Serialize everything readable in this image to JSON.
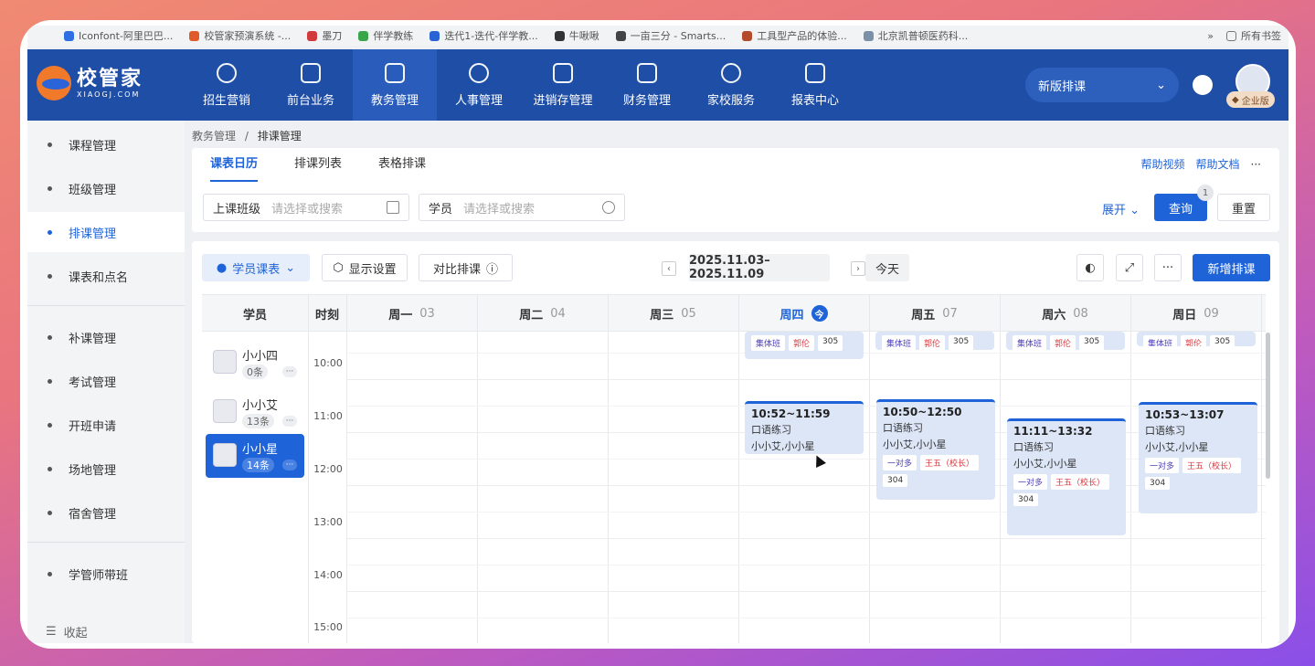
{
  "bookmarks": [
    {
      "label": "Iconfont-阿里巴巴...",
      "color": "#2f6fe4"
    },
    {
      "label": "校管家预演系统 -...",
      "color": "#e05a2a"
    },
    {
      "label": "墨刀",
      "color": "#d23b3b"
    },
    {
      "label": "伴学教练",
      "color": "#3aa64a"
    },
    {
      "label": "迭代1-迭代-伴学教...",
      "color": "#2a63d4"
    },
    {
      "label": "牛啾啾",
      "color": "#333333"
    },
    {
      "label": "一亩三分 - Smarts...",
      "color": "#444444"
    },
    {
      "label": "工具型产品的体验...",
      "color": "#b34a2a"
    },
    {
      "label": "北京凯普顿医药科...",
      "color": "#7a8fa8"
    }
  ],
  "bookmarks_more": "»",
  "bookmarks_folder": "所有书签",
  "logo": {
    "main": "校管家",
    "sub": "XIAOGJ.COM"
  },
  "nav": [
    {
      "label": "招生营销",
      "icon": "user-add-icon"
    },
    {
      "label": "前台业务",
      "icon": "reception-icon"
    },
    {
      "label": "教务管理",
      "icon": "academic-icon",
      "active": true
    },
    {
      "label": "人事管理",
      "icon": "person-icon"
    },
    {
      "label": "进销存管理",
      "icon": "inventory-icon"
    },
    {
      "label": "财务管理",
      "icon": "finance-icon"
    },
    {
      "label": "家校服务",
      "icon": "chat-icon"
    },
    {
      "label": "报表中心",
      "icon": "report-icon"
    }
  ],
  "header": {
    "select": "新版排课",
    "badge": "企业版"
  },
  "sidebar": {
    "group1": [
      "课程管理",
      "班级管理",
      "排课管理",
      "课表和点名"
    ],
    "group2": [
      "补课管理",
      "考试管理",
      "开班申请",
      "场地管理",
      "宿舍管理"
    ],
    "group3": [
      "学管师带班"
    ],
    "collapse": "收起"
  },
  "breadcrumb": {
    "parent": "教务管理",
    "sep": "/",
    "current": "排课管理"
  },
  "tabs": [
    "课表日历",
    "排课列表",
    "表格排课"
  ],
  "help": {
    "video": "帮助视频",
    "docs": "帮助文档",
    "more": "···"
  },
  "filters": {
    "class_label": "上课班级",
    "class_placeholder": "请选择或搜索",
    "student_label": "学员",
    "student_placeholder": "请选择或搜索",
    "expand": "展开",
    "query": "查询",
    "query_badge": "1",
    "reset": "重置"
  },
  "toolbar": {
    "view": "学员课表",
    "display": "显示设置",
    "compare": "对比排课",
    "date_range": "2025.11.03–2025.11.09",
    "prev": "‹",
    "next": "›",
    "today": "今天",
    "more": "···",
    "add": "新增排课"
  },
  "grid": {
    "col_student": "学员",
    "col_time": "时刻",
    "days": [
      {
        "label": "周一",
        "num": "03"
      },
      {
        "label": "周二",
        "num": "04"
      },
      {
        "label": "周三",
        "num": "05"
      },
      {
        "label": "周四",
        "num": "今",
        "today": true
      },
      {
        "label": "周五",
        "num": "07"
      },
      {
        "label": "周六",
        "num": "08"
      },
      {
        "label": "周日",
        "num": "09"
      }
    ],
    "times": [
      "10:00",
      "11:00",
      "12:00",
      "13:00",
      "14:00",
      "15:00"
    ]
  },
  "students": [
    {
      "name": "小小四",
      "count": "0条",
      "more": "···"
    },
    {
      "name": "小小艾",
      "count": "13条",
      "more": "···"
    },
    {
      "name": "小小星",
      "count": "14条",
      "more": "···",
      "active": true
    }
  ],
  "partial_events": [
    {
      "tags": [
        "集体班",
        "郭伦",
        "305"
      ]
    },
    {
      "tags": [
        "集体班",
        "郭伦",
        "305"
      ]
    },
    {
      "tags": [
        "集体班",
        "郭伦",
        "305"
      ]
    },
    {
      "tags": [
        "集体班",
        "郭伦",
        "305"
      ]
    }
  ],
  "events": [
    {
      "time": "10:52~11:59",
      "course": "口语练习",
      "students": "小小艾,小小星",
      "tags": []
    },
    {
      "time": "10:50~12:50",
      "course": "口语练习",
      "students": "小小艾,小小星",
      "tags": [
        "一对多",
        "王五（校长）",
        "304"
      ]
    },
    {
      "time": "11:11~13:32",
      "course": "口语练习",
      "students": "小小艾,小小星",
      "tags": [
        "一对多",
        "王五（校长）",
        "304"
      ]
    },
    {
      "time": "10:53~13:07",
      "course": "口语练习",
      "students": "小小艾,小小星",
      "tags": [
        "一对多",
        "王五（校长）",
        "304"
      ]
    }
  ],
  "colors": {
    "primary": "#1f63d8",
    "nav_bg": "#1f4ea6",
    "event_bg": "#dce6f7",
    "tag_red": "#d9363e",
    "tag_purple": "#4c3fb8"
  }
}
